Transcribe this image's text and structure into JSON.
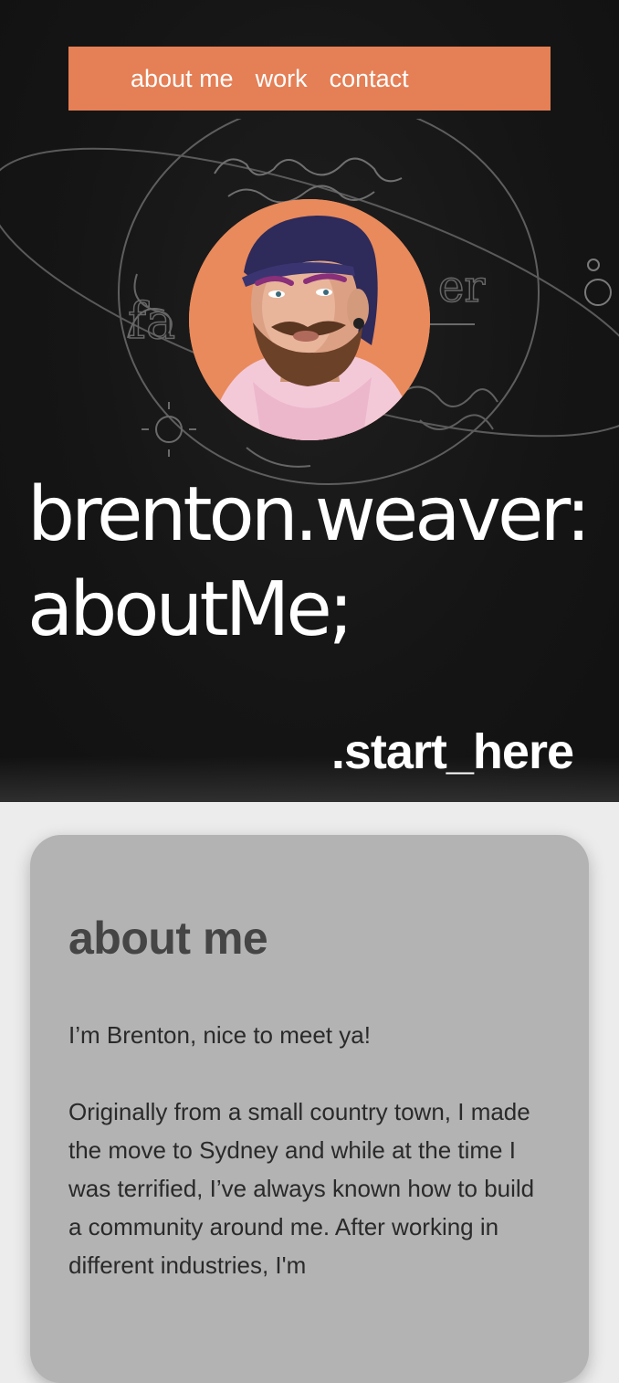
{
  "nav": {
    "items": [
      {
        "label": "about me"
      },
      {
        "label": "work"
      },
      {
        "label": "contact"
      }
    ]
  },
  "hero": {
    "title_line1": "brenton.weaver:",
    "title_line2": "aboutMe;",
    "cta": ".start_here"
  },
  "about": {
    "heading": "about me",
    "paragraphs": [
      "I’m Brenton, nice to meet ya!",
      "Originally from a small country town, I made the move to Sydney and while at the time I was terrified, I’ve always known how to build a community around me. After working in different industries, I'm"
    ]
  },
  "colors": {
    "accent": "#e57f55",
    "hero_bg": "#151515",
    "card_bg": "#b3b3b3",
    "page_bg": "#ececec"
  }
}
